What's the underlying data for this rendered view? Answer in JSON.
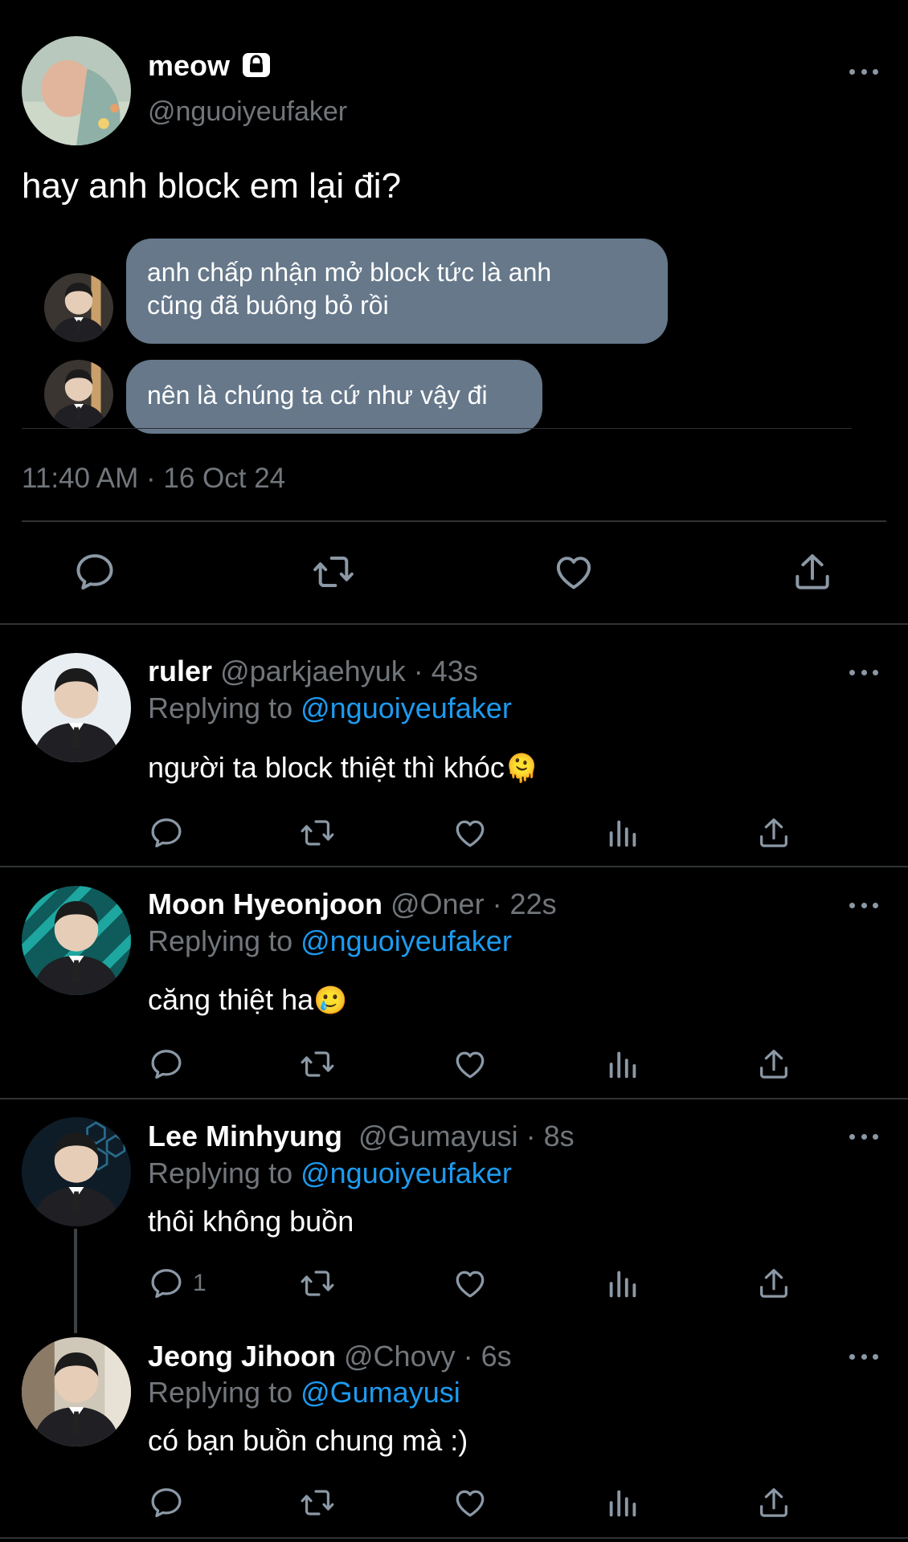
{
  "main_tweet": {
    "display_name": "meow",
    "handle": "@nguoiyeufaker",
    "text": "hay anh block em lại đi?",
    "chat": {
      "message_1_line_1": "anh chấp nhận mở block tức là anh",
      "message_1_line_2": "cũng đã buông bỏ rồi",
      "message_2": "nên là chúng ta cứ như vậy đi"
    },
    "timestamp": "11:40 AM · 16 Oct 24"
  },
  "replies": [
    {
      "name": "ruler",
      "handle_time": "@parkjaehyuk · 43s",
      "replying_prefix": "Replying to ",
      "replying_to": "@nguoiyeufaker",
      "text": "người ta block thiệt thì khóc",
      "emoji": "🫠",
      "reply_count": ""
    },
    {
      "name": "Moon Hyeonjoon",
      "handle_time": "@Oner · 22s",
      "replying_prefix": "Replying to ",
      "replying_to": "@nguoiyeufaker",
      "text": "căng thiệt ha",
      "emoji": "🥲",
      "reply_count": ""
    },
    {
      "name": "Lee Minhyung",
      "handle_time": "@Gumayusi · 8s",
      "replying_prefix": "Replying to ",
      "replying_to": "@nguoiyeufaker",
      "text": "thôi không buồn",
      "reply_count": "1"
    },
    {
      "name": "Jeong Jihoon",
      "handle_time": "@Chovy · 6s",
      "replying_prefix": "Replying to ",
      "replying_to": "@Gumayusi",
      "text": "có bạn buồn chung mà :)",
      "reply_count": ""
    }
  ],
  "icons": {
    "reply": "speech-bubble-icon",
    "retweet": "retweet-icon",
    "like": "heart-icon",
    "views": "bar-chart-icon",
    "share": "share-icon",
    "more": "more-dots-icon",
    "lock": "lock-icon"
  },
  "colors": {
    "background": "#000000",
    "text": "#ffffff",
    "secondary": "#71767b",
    "link": "#1d9bf0",
    "divider": "#2f3336",
    "chat_bubble": "#66788a"
  }
}
